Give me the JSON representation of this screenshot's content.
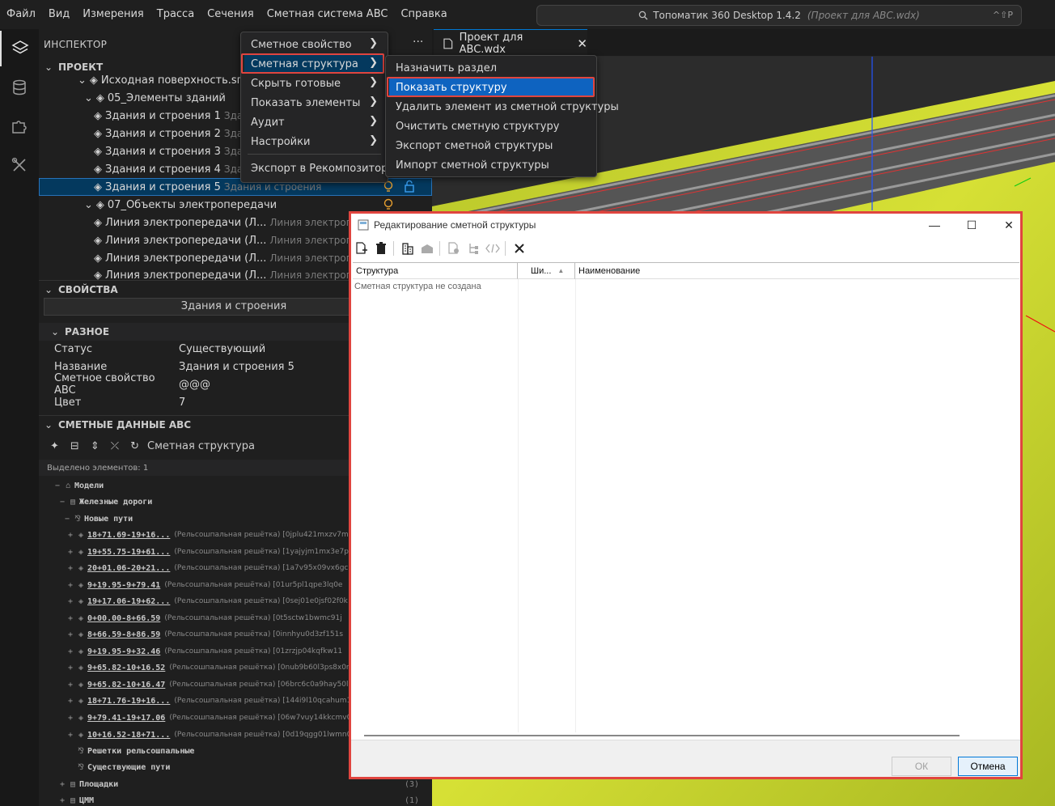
{
  "menubar": {
    "items": [
      "Файл",
      "Вид",
      "Измерения",
      "Трасса",
      "Сечения",
      "Сметная система ABC",
      "Справка"
    ],
    "search_title": "Топоматик 360 Desktop 1.4.2",
    "search_project": "(Проект для ABC.wdx)",
    "search_shortcut": "^⇧P"
  },
  "activity": {
    "icons": [
      "layers-icon",
      "database-icon",
      "puzzle-icon",
      "tools-icon"
    ]
  },
  "sidebar": {
    "title": "ИНСПЕКТОР",
    "more": "···",
    "project_header": "ПРОЕКТ",
    "tree": [
      {
        "label": "Исходная поверхность.sгcx",
        "muted": ""
      },
      {
        "label": "05_Элементы зданий",
        "muted": ""
      },
      {
        "label": "Здания и строения 1",
        "muted": "Здания и строения"
      },
      {
        "label": "Здания и строения 2",
        "muted": "Здания и строения"
      },
      {
        "label": "Здания и строения 3",
        "muted": "Здания и строения"
      },
      {
        "label": "Здания и строения 4",
        "muted": "Здания и строения"
      },
      {
        "label": "Здания и строения 5",
        "muted": "Здания и строения"
      },
      {
        "label": "07_Объекты электропередачи",
        "muted": ""
      },
      {
        "label": "Линия электропередачи (Л...",
        "muted": "Линия электропередачи"
      },
      {
        "label": "Линия электропередачи (Л...",
        "muted": "Линия электропередачи"
      },
      {
        "label": "Линия электропередачи (Л...",
        "muted": "Линия электропередачи"
      },
      {
        "label": "Линия электропередачи (Л...",
        "muted": "Линия электропередачи"
      }
    ],
    "props_header": "СВОЙСТВА",
    "props_button": "Здания и строения",
    "misc_header": "РАЗНОЕ",
    "props": [
      {
        "k": "Статус",
        "v": "Существующий"
      },
      {
        "k": "Название",
        "v": "Здания и строения 5"
      },
      {
        "k": "Сметное свойство ABC",
        "v": "@@@"
      },
      {
        "k": "Цвет",
        "v": "7"
      }
    ],
    "est_header": "СМЕТНЫЕ ДАННЫЕ ABC",
    "est_tool_label": "Сметная структура",
    "selected_count": "Выделено элементов: 1",
    "est_tree": {
      "models": "Модели",
      "railroads": "Железные дороги",
      "new_tracks": "Новые пути",
      "items": [
        {
          "station": "18+71.69-19+16...",
          "desc": "(Рельсошпальная решётка) [0jplu421mxzv7m1r"
        },
        {
          "station": "19+55.75-19+61...",
          "desc": "(Рельсошпальная решётка) [1yajyjm1mx3e7p1v"
        },
        {
          "station": "20+01.06-20+21...",
          "desc": "(Рельсошпальная решётка) [1a7v95x09vx6gc05"
        },
        {
          "station": "9+19.95-9+79.41",
          "desc": "(Рельсошпальная решётка) [01ur5pl1qpe3lq0e"
        },
        {
          "station": "19+17.06-19+62...",
          "desc": "(Рельсошпальная решётка) [0sej01e0jsf02f0k"
        },
        {
          "station": "0+00.00-8+66.59",
          "desc": "(Рельсошпальная решётка) [0t5sctw1bwmc91j"
        },
        {
          "station": "8+66.59-8+86.59",
          "desc": "(Рельсошпальная решётка) [0innhyu0d3zf151s"
        },
        {
          "station": "9+19.95-9+32.46",
          "desc": "(Рельсошпальная решётка) [01zrzjp04kqfkw11"
        },
        {
          "station": "9+65.82-10+16.52",
          "desc": "(Рельсошпальная решётка) [0nub9b60l3ps8x0r"
        },
        {
          "station": "9+65.82-10+16.47",
          "desc": "(Рельсошпальная решётка) [06brc6c0a9hay50l"
        },
        {
          "station": "18+71.76-19+16...",
          "desc": "(Рельсошпальная решётка) [144i9l10qcahum18"
        },
        {
          "station": "9+79.41-19+17.06",
          "desc": "(Рельсошпальная решётка) [06w7vuy14kkcmv09"
        },
        {
          "station": "10+16.52-18+71...",
          "desc": "(Рельсошпальная решётка) [0d19qgg01lwmn00e"
        }
      ],
      "grid": "Решетки рельсошпальные",
      "existing": "Существующие пути",
      "sites": "Площадки",
      "sites_count": "(3)",
      "dtm": "ЦММ",
      "dtm_count": "(1)"
    }
  },
  "editor_tab": {
    "label": "Проект для ABC.wdx",
    "close": "✕"
  },
  "menu1": {
    "items": [
      "Сметное свойство",
      "Сметная структура",
      "Скрыть готовые",
      "Показать элементы",
      "Аудит",
      "Настройки",
      "Экспорт в Рекомпозитор"
    ],
    "arrow": "❯"
  },
  "menu2": {
    "items": [
      "Назначить раздел",
      "Показать структуру",
      "Удалить элемент из сметной структуры",
      "Очистить сметную структуру",
      "Экспорт сметной структуры",
      "Импорт сметной структуры"
    ]
  },
  "dialog": {
    "title": "Редактирование сметной структуры",
    "minimize": "—",
    "maximize": "☐",
    "close": "✕",
    "columns": [
      "Структура",
      "Ши...",
      "Наименование"
    ],
    "sort_glyph": "▲",
    "empty_text": "Сметная структура не создана",
    "ok": "ОК",
    "cancel": "Отмена"
  },
  "colors": {
    "accent": "#0078d4",
    "highlight_red": "#e0453f",
    "menu_selected": "#0e63c0",
    "terrain_yellow": "#c8d42a"
  }
}
